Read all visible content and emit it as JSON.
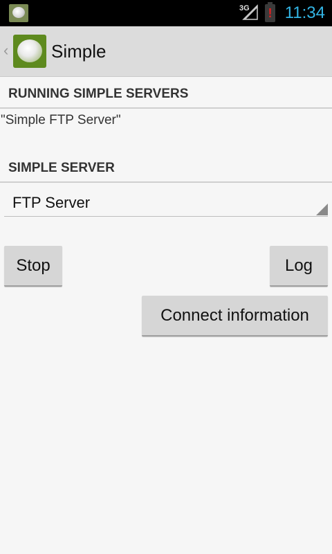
{
  "status_bar": {
    "network_label": "3G",
    "battery_alert": "!",
    "time": "11:34",
    "colors": {
      "time": "#33b5e5",
      "battery_alert": "#e02020"
    }
  },
  "action_bar": {
    "up_indicator": "‹",
    "title": "Simple",
    "logo_icon": "disc-icon"
  },
  "sections": {
    "running": {
      "header": "RUNNING SIMPLE SERVERS",
      "items": [
        "\"Simple FTP Server\""
      ]
    },
    "server": {
      "header": "SIMPLE SERVER",
      "selected": "FTP Server"
    }
  },
  "buttons": {
    "stop": "Stop",
    "log": "Log",
    "connect": "Connect information"
  }
}
